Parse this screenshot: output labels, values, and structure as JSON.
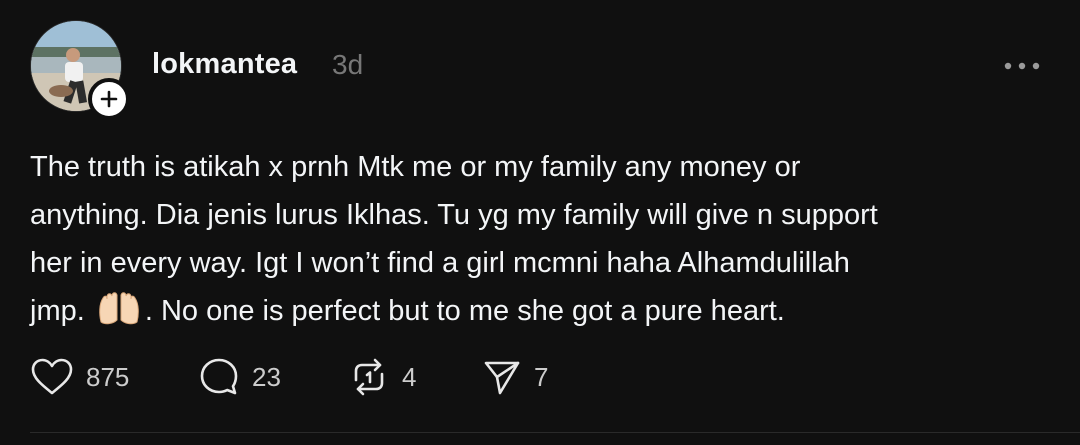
{
  "post": {
    "username": "lokmantea",
    "timestamp": "3d",
    "text_lines": [
      "The truth is atikah x prnh Mtk me or my family any money or",
      "anything. Dia jenis lurus Iklhas. Tu yg my family will give n support",
      "her in every way. Igt I won’t find a girl mcmni haha Alhamdulillah"
    ],
    "last_line_before_emoji": "jmp.",
    "last_line_after_emoji": ". No one is perfect but to me she got a pure heart."
  },
  "actions": {
    "likes": "875",
    "replies": "23",
    "reposts": "4",
    "shares": "7"
  },
  "icons": {
    "follow": "plus-icon",
    "more": "more-horizontal-icon",
    "like": "heart-icon",
    "reply": "comment-icon",
    "repost": "repost-icon",
    "share": "send-icon",
    "emoji": "raising-hands-emoji"
  },
  "colors": {
    "background": "#101010",
    "text": "#f3f5f7",
    "muted": "#777777"
  }
}
